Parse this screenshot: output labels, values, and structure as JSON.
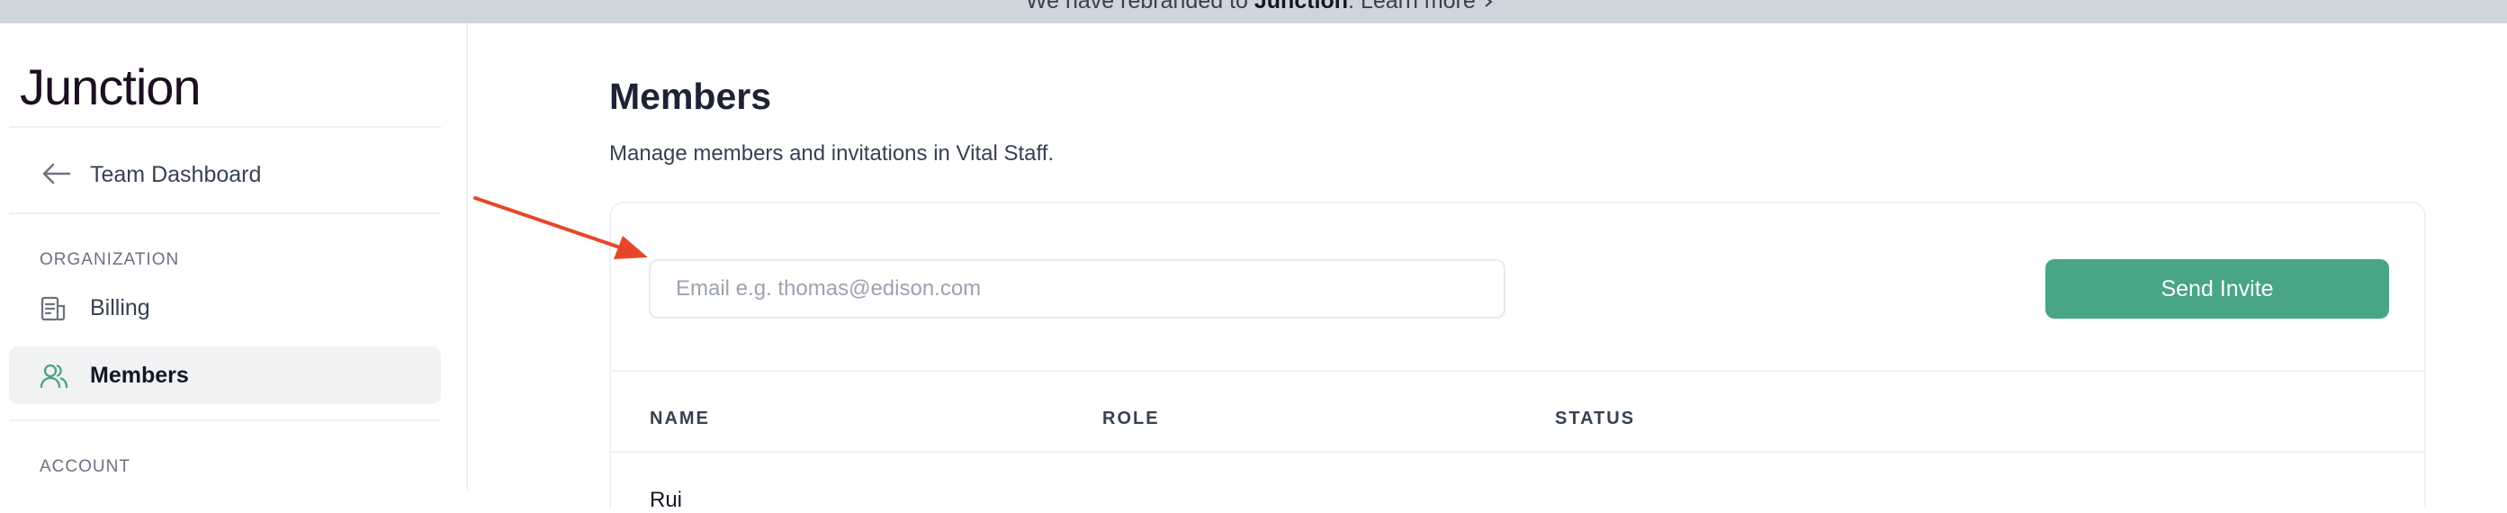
{
  "banner": {
    "text_before": "We have rebranded to ",
    "brand": "Junction",
    "text_after": ". Learn more",
    "arrow_icon": "chevron-right-icon"
  },
  "sidebar": {
    "logo": "Junction",
    "back_item": {
      "label": "Team Dashboard",
      "icon": "arrow-left-icon"
    },
    "sections": [
      {
        "title": "ORGANIZATION",
        "items": [
          {
            "label": "Billing",
            "icon": "receipt-icon",
            "active": false
          },
          {
            "label": "Members",
            "icon": "users-icon",
            "active": true
          }
        ]
      },
      {
        "title": "ACCOUNT",
        "items": []
      }
    ]
  },
  "main": {
    "title": "Members",
    "subtitle": "Manage members and invitations in Vital Staff.",
    "invite": {
      "email_placeholder": "Email e.g. thomas@edison.com",
      "email_value": "",
      "send_label": "Send Invite"
    },
    "table": {
      "columns": [
        "NAME",
        "ROLE",
        "STATUS"
      ],
      "rows": [
        {
          "name": "Rui",
          "role": "",
          "status": ""
        }
      ]
    }
  },
  "colors": {
    "accent": "#48a586",
    "banner_bg": "#cfd5dd",
    "active_nav_bg": "#f1f2f4",
    "annotation_arrow": "#e8462a"
  }
}
